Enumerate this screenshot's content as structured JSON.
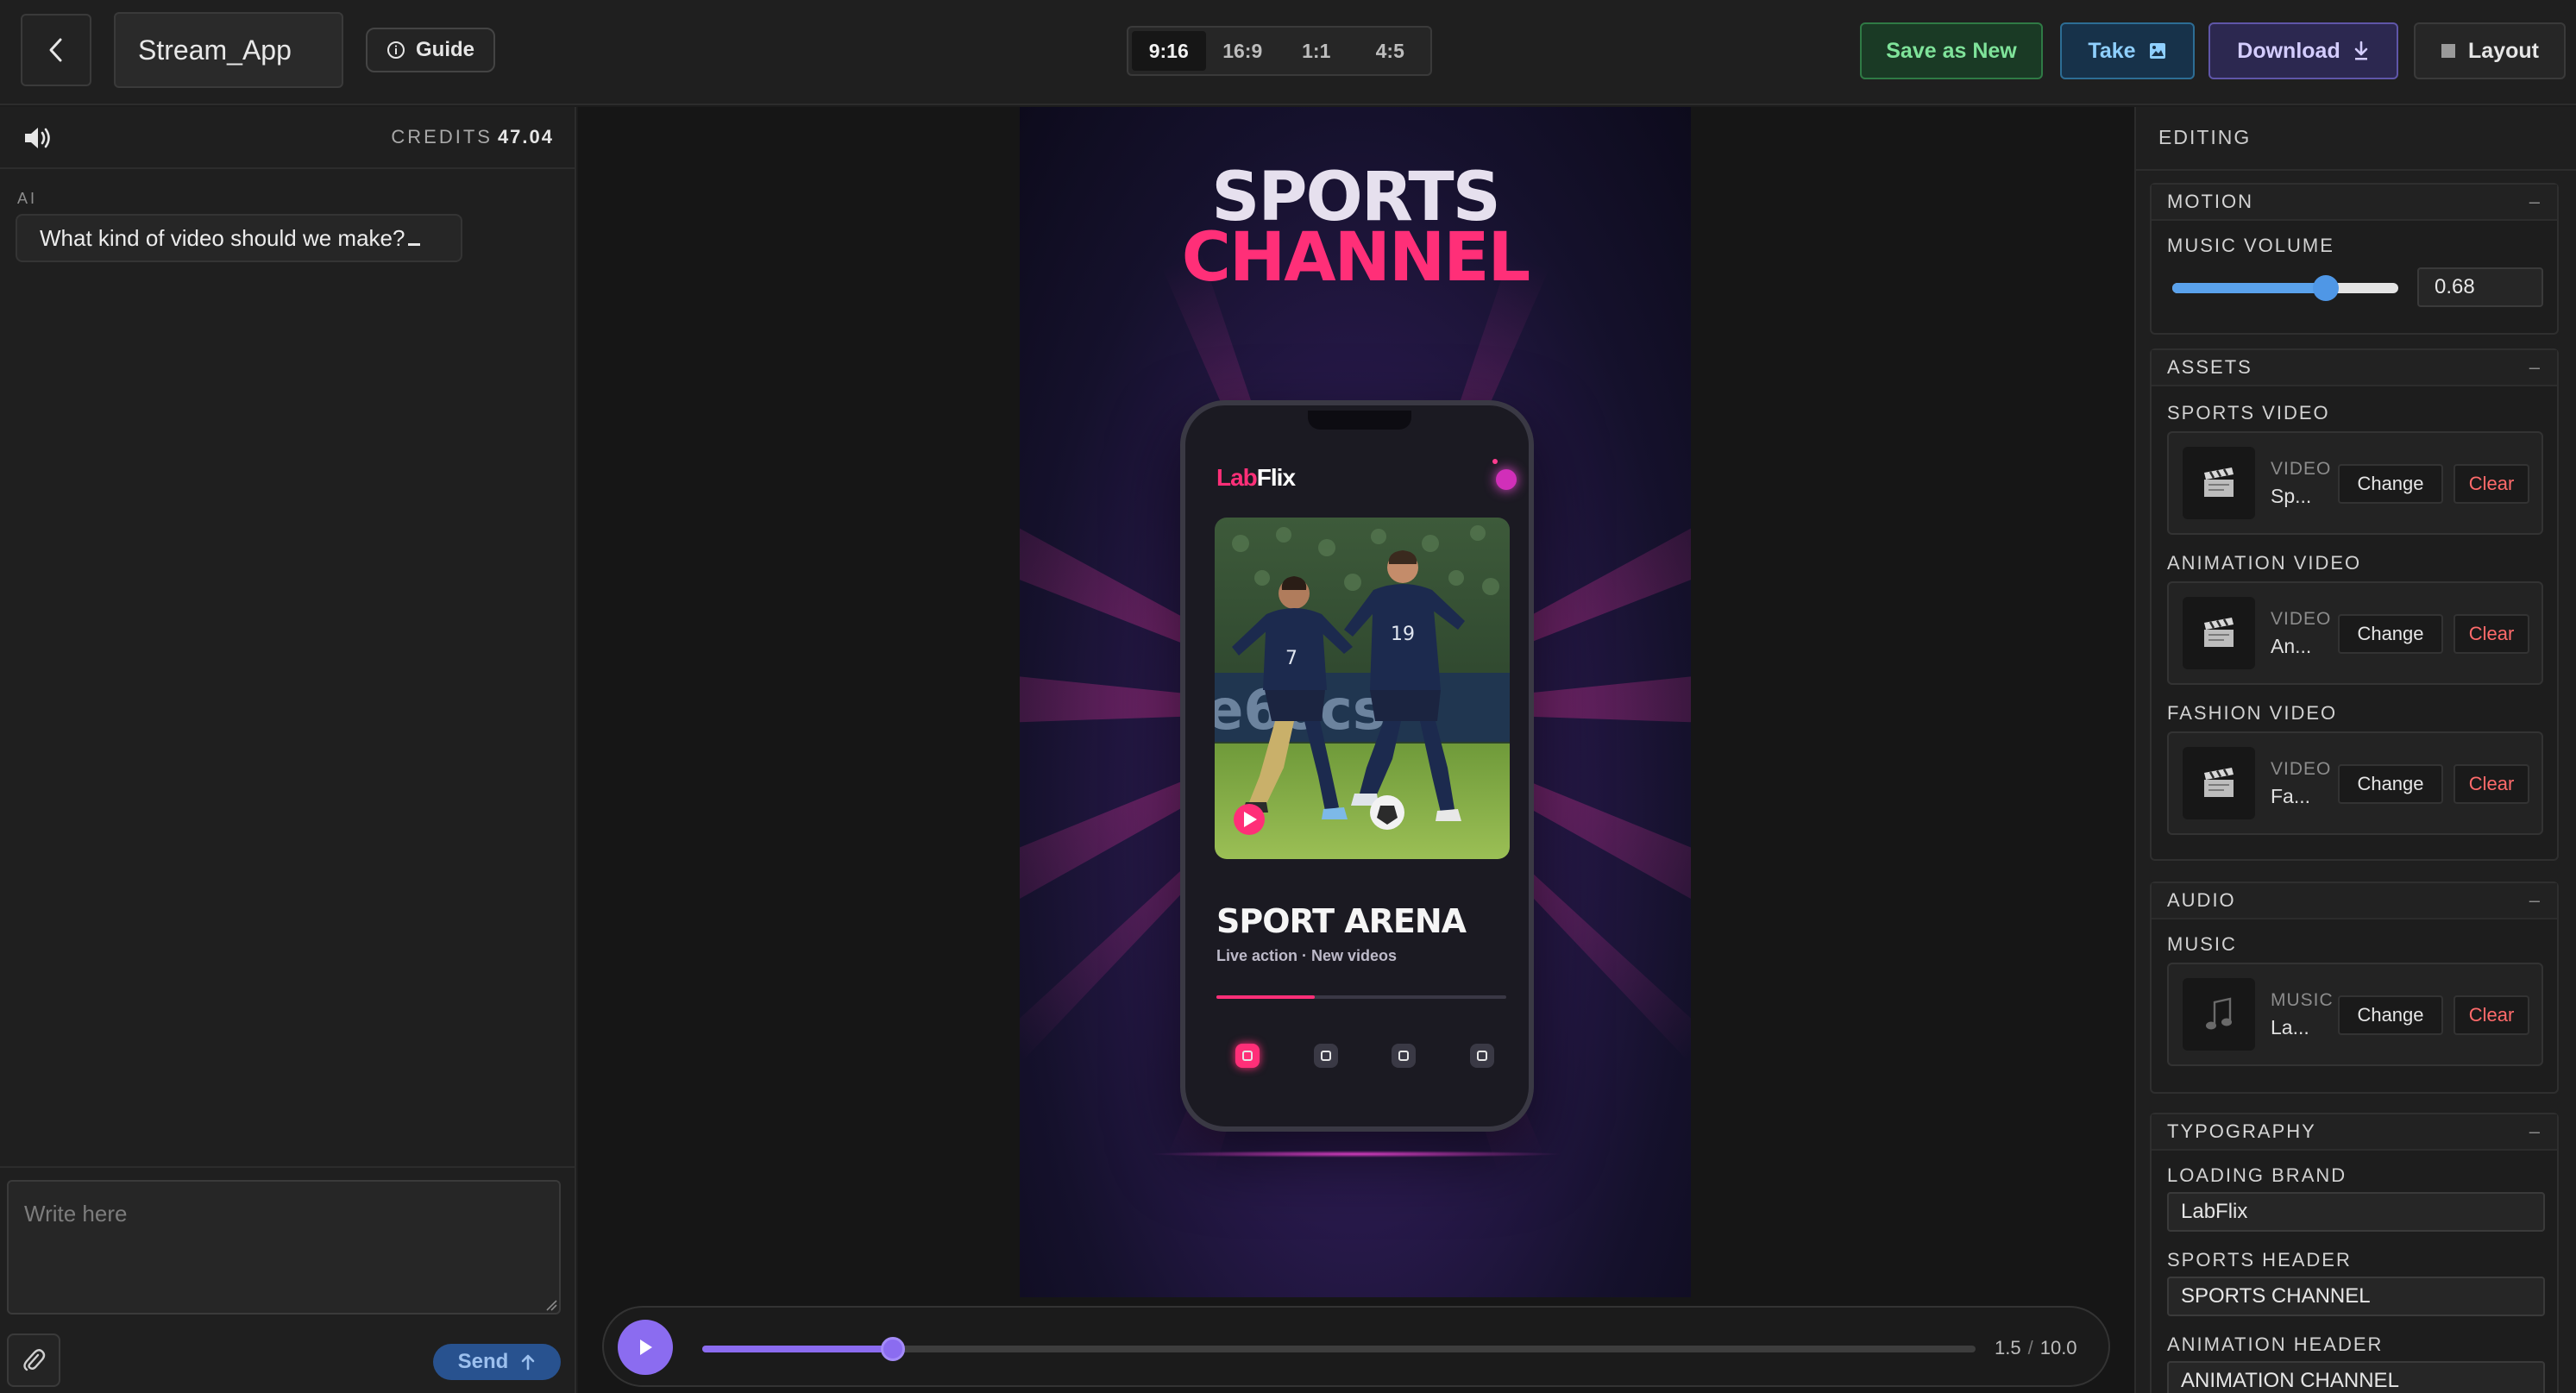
{
  "header": {
    "project_title": "Stream_App",
    "guide_label": "Guide",
    "aspect_ratios": [
      "9:16",
      "16:9",
      "1:1",
      "4:5"
    ],
    "selected_ratio": "9:16",
    "save_label": "Save as New",
    "take_label": "Take",
    "download_label": "Download",
    "layout_label": "Layout"
  },
  "left": {
    "credits_label": "CREDITS",
    "credits_value": "47.04",
    "ai_label": "AI",
    "ai_message": "What kind of video should we make?",
    "input_placeholder": "Write here",
    "send_label": "Send"
  },
  "preview": {
    "title_line1": "SPORTS",
    "title_line2": "CHANNEL",
    "phone_brand_a": "Lab",
    "phone_brand_b": "Flix",
    "phone_title": "SPORT ARENA",
    "phone_subtitle": "Live action · New videos",
    "phone_progress": 0.34,
    "jersey_left": "7",
    "jersey_right": "19"
  },
  "timeline": {
    "current": "1.5",
    "total": "10.0",
    "progress": 0.15
  },
  "editing": {
    "title": "EDITING",
    "motion": {
      "title": "MOTION",
      "music_volume_label": "MUSIC VOLUME",
      "music_volume_value": "0.68",
      "music_volume": 0.68
    },
    "assets": {
      "title": "ASSETS",
      "items": [
        {
          "label": "SPORTS VIDEO",
          "kind": "VIDEO",
          "name": "Sp..."
        },
        {
          "label": "ANIMATION VIDEO",
          "kind": "VIDEO",
          "name": "An..."
        },
        {
          "label": "FASHION VIDEO",
          "kind": "VIDEO",
          "name": "Fa..."
        }
      ]
    },
    "audio": {
      "title": "AUDIO",
      "items": [
        {
          "label": "MUSIC",
          "kind": "MUSIC",
          "name": "La..."
        }
      ]
    },
    "typography": {
      "title": "TYPOGRAPHY",
      "fields": [
        {
          "label": "LOADING BRAND",
          "value": "LabFlix"
        },
        {
          "label": "SPORTS HEADER",
          "value": "SPORTS CHANNEL"
        },
        {
          "label": "ANIMATION HEADER",
          "value": "ANIMATION CHANNEL"
        }
      ]
    },
    "change_label": "Change",
    "clear_label": "Clear",
    "collapse_symbol": "–"
  },
  "colors": {
    "accent_purple": "#8b6cf0",
    "brand_pink": "#ff2f78",
    "slider_blue": "#4f97e6",
    "clear_red": "#ff6b6b",
    "save_green": "#7fe39a"
  },
  "icons": [
    "back-chevron-icon",
    "info-icon",
    "image-icon",
    "download-icon",
    "layout-icon",
    "speaker-icon",
    "paperclip-icon",
    "arrow-up-icon",
    "play-icon",
    "clapperboard-icon",
    "music-note-icon"
  ]
}
